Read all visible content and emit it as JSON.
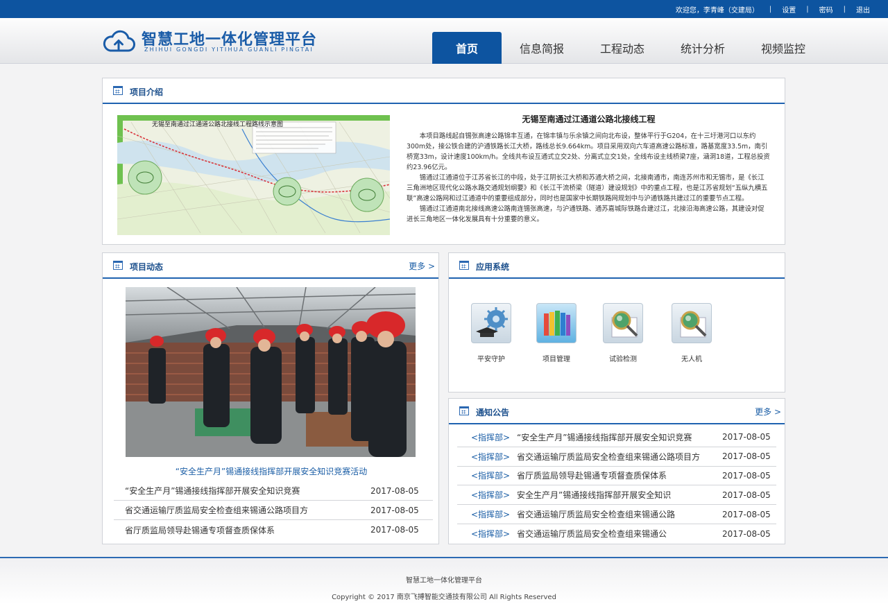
{
  "topbar": {
    "welcome": "欢迎您，李青峰（交建局）",
    "settings": "设置",
    "password": "密码",
    "logout": "退出"
  },
  "logo": {
    "title": "智慧工地一体化管理平台",
    "pinyin": "ZHIHUI GONGDI YITIHUA GUANLI PINGTAI"
  },
  "nav": {
    "items": [
      "首页",
      "信息简报",
      "工程动态",
      "统计分析",
      "视频监控"
    ],
    "active": 0
  },
  "intro": {
    "heading": "项目介绍",
    "project_title": "无锡至南通过江通道公路北接线工程",
    "map_caption": "无锡至南通过江通道公路北接线工程路线示意图",
    "paragraphs": [
      "本项目路线起自锡张高速公路锦丰互通，在锦丰镇与乐余镇之间向北布设，整体平行于G204，在十三圩港河口以东约300m处，接公铁合建的沪通铁路长江大桥，路线总长9.664km。项目采用双向六车道高速公路标准，路基宽度33.5m，南引桥宽33m，设计速度100km/h。全线共布设互通式立交2处、分离式立交1处，全线布设主线桥梁7座，涵洞18道，工程总投资约23.96亿元。",
      "锡通过江通道位于江苏省长江的中段，处于江阴长江大桥和苏通大桥之间，北接南通市，南连苏州市和无锡市，是《长江三角洲地区现代化公路水路交通规划纲要》和《长江干流桥梁（隧道）建设规划》中的重点工程，也是江苏省规划“五纵九横五联”高速公路网和过江通道中的重要组成部分，同时也是国家中长期铁路网规划中与沪通铁路共建过江的重要节点工程。",
      "锡通过江通道南北接线高速公路南连锡张高速，与沪通铁路、通苏嘉城际铁路合建过江，北接沿海高速公路，其建设对促进长三角地区一体化发展具有十分重要的意义。"
    ]
  },
  "news": {
    "heading": "项目动态",
    "more": "更多 >",
    "caption": "“安全生产月”锡通接线指挥部开展安全知识竞赛活动",
    "items": [
      {
        "title": "“安全生产月”锡通接线指挥部开展安全知识竞赛",
        "date": "2017-08-05"
      },
      {
        "title": "省交通运输厅质监局安全检查组来锡通公路项目方",
        "date": "2017-08-05"
      },
      {
        "title": "省厅质监局领导赴锡通专项督查质保体系",
        "date": "2017-08-05"
      }
    ]
  },
  "apps": {
    "heading": "应用系统",
    "items": [
      {
        "label": "平安守护",
        "icon": "safety-guard-icon"
      },
      {
        "label": "项目管理",
        "icon": "project-books-icon"
      },
      {
        "label": "试验检测",
        "icon": "test-magnifier-icon"
      },
      {
        "label": "无人机",
        "icon": "drone-magnifier-icon"
      }
    ]
  },
  "notice": {
    "heading": "通知公告",
    "more": "更多 >",
    "items": [
      {
        "source": "<指挥部>",
        "title": "“安全生产月”锡通接线指挥部开展安全知识竞赛",
        "date": "2017-08-05"
      },
      {
        "source": "<指挥部>",
        "title": "省交通运输厅质监局安全检查组来锡通公路项目方",
        "date": "2017-08-05"
      },
      {
        "source": "<指挥部>",
        "title": "省厅质监局领导赴锡通专项督查质保体系",
        "date": "2017-08-05"
      },
      {
        "source": "<指挥部>",
        "title": "安全生产月”锡通接线指挥部开展安全知识",
        "date": "2017-08-05"
      },
      {
        "source": "<指挥部>",
        "title": "省交通运输厅质监局安全检查组来锡通公路",
        "date": "2017-08-05"
      },
      {
        "source": "<指挥部>",
        "title": "省交通运输厅质监局安全检查组来锡通公",
        "date": "2017-08-05"
      }
    ]
  },
  "footer": {
    "platform": "智慧工地一体化管理平台",
    "copyright": "Copyright © 2017 南京飞搏智能交通技有限公司 All Rights Reserved"
  },
  "colors": {
    "brand": "#0d54a0",
    "link": "#1b5ea6"
  }
}
